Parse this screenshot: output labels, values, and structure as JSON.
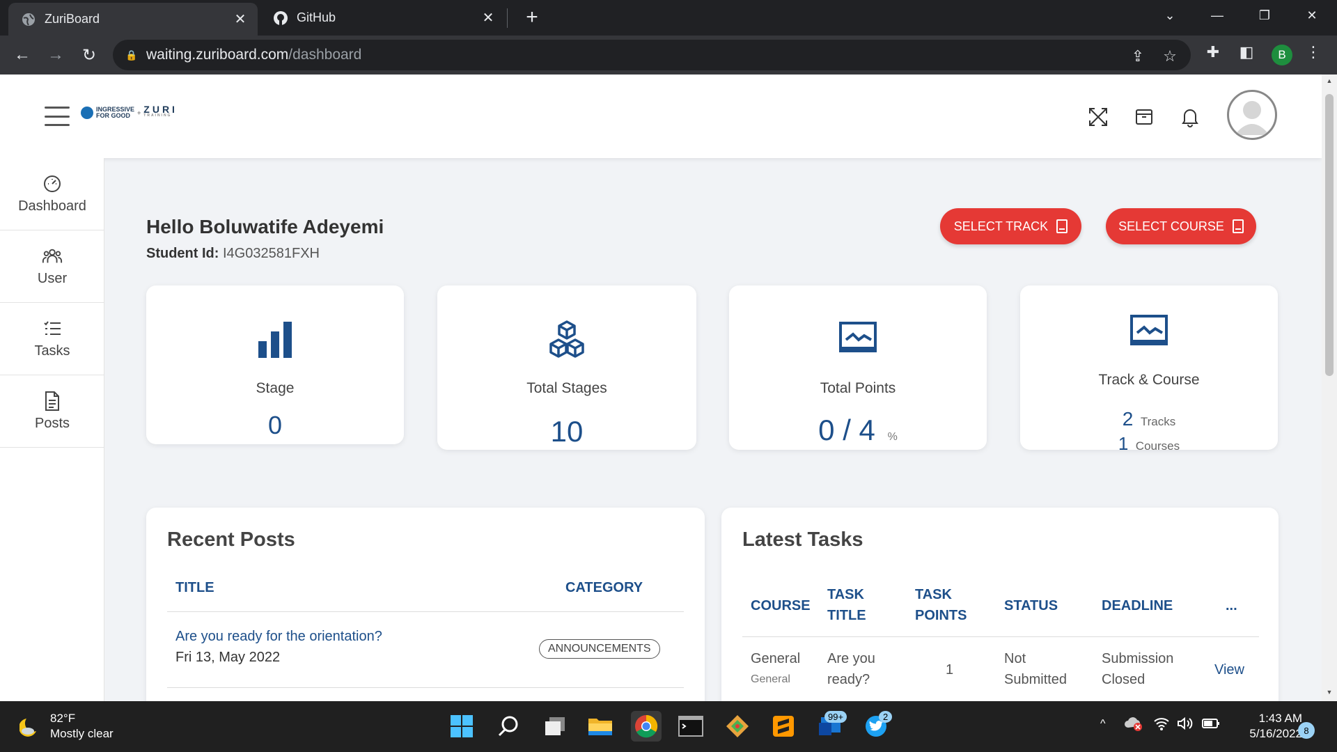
{
  "browser": {
    "tabs": [
      {
        "title": "ZuriBoard",
        "active": true
      },
      {
        "title": "GitHub",
        "active": false
      }
    ],
    "url_host": "waiting.zuriboard.com",
    "url_path": "/dashboard",
    "profile_initial": "B"
  },
  "header": {
    "logo_text_1": "INGRESSIVE",
    "logo_text_2": "FOR GOOD",
    "logo_plus": "+",
    "logo_zuri": "ZURI",
    "logo_sub": "TRAINING"
  },
  "sidebar": {
    "items": [
      {
        "label": "Dashboard",
        "icon": "speedometer-icon"
      },
      {
        "label": "User",
        "icon": "users-icon"
      },
      {
        "label": "Tasks",
        "icon": "checklist-icon"
      },
      {
        "label": "Posts",
        "icon": "document-icon"
      }
    ]
  },
  "main": {
    "greeting": "Hello Boluwatife Adeyemi",
    "student_id_label": "Student Id:",
    "student_id_value": "I4G032581FXH",
    "buttons": {
      "select_track": "SELECT TRACK",
      "select_course": "SELECT COURSE"
    },
    "stats": {
      "stage": {
        "label": "Stage",
        "value": "0"
      },
      "total_stages": {
        "label": "Total Stages",
        "value": "10"
      },
      "total_points": {
        "label": "Total Points",
        "value": "0 / 4",
        "unit": "%"
      },
      "track_course": {
        "label": "Track & Course",
        "tracks_count": "2",
        "tracks_label": "Tracks",
        "courses_count": "1",
        "courses_label": "Courses"
      }
    },
    "recent_posts": {
      "title": "Recent Posts",
      "columns": [
        "TITLE",
        "CATEGORY"
      ],
      "rows": [
        {
          "title": "Are you ready for the orientation?",
          "date": "Fri 13, May 2022",
          "category": "ANNOUNCEMENTS"
        }
      ]
    },
    "latest_tasks": {
      "title": "Latest Tasks",
      "columns": [
        "COURSE",
        "TASK TITLE",
        "TASK POINTS",
        "STATUS",
        "DEADLINE",
        "..."
      ],
      "rows": [
        {
          "course": "General",
          "course_sub": "General",
          "task_title": "Are you ready?",
          "points": "1",
          "status": "Not Submitted",
          "deadline": "Submission Closed",
          "action": "View"
        }
      ]
    }
  },
  "taskbar": {
    "weather_temp": "82°F",
    "weather_cond": "Mostly clear",
    "mail_badge": "99+",
    "twitter_badge": "2",
    "time": "1:43 AM",
    "date": "5/16/2022",
    "notifications": "8"
  },
  "colors": {
    "accent_red": "#e53935",
    "primary_blue": "#1d4f8a"
  }
}
